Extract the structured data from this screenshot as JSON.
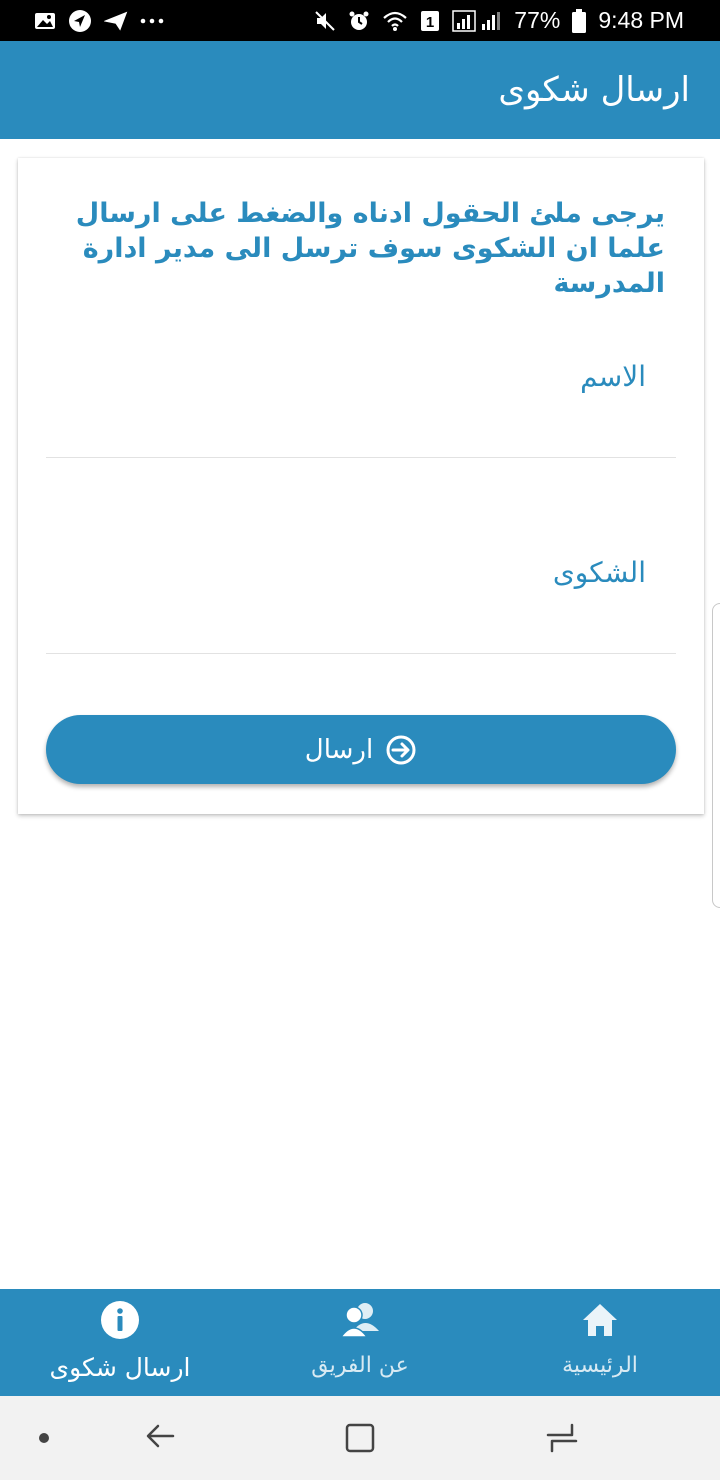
{
  "status_bar": {
    "battery_percent": "77%",
    "time": "9:48 PM",
    "sim_badge": "1"
  },
  "app_bar": {
    "title": "ارسال شكوى"
  },
  "form": {
    "instructions": "يرجى ملئ الحقول ادناه والضغط على ارسال علما ان الشكوى سوف ترسل الى مدير ادارة المدرسة",
    "name_label": "الاسم",
    "complaint_label": "الشكوى",
    "send_label": "ارسال"
  },
  "bottom_nav": {
    "items": [
      {
        "label": "ارسال شكوى",
        "icon": "info-icon",
        "active": true
      },
      {
        "label": "عن الفريق",
        "icon": "team-icon",
        "active": false
      },
      {
        "label": "الرئيسية",
        "icon": "home-icon",
        "active": false
      }
    ]
  },
  "colors": {
    "primary": "#2a8bbd",
    "status_bar": "#000000",
    "system_nav": "#f2f2f2",
    "divider": "#e2e2e2"
  }
}
